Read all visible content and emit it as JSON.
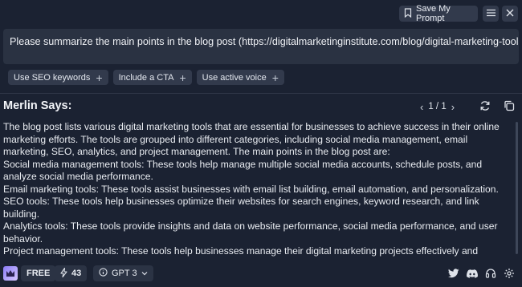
{
  "topbar": {
    "save_label": "Save My Prompt"
  },
  "prompt": {
    "text": "Please summarize the main points in the blog post (https://digitalmarketinginstitute.com/blog/digital-marketing-tools)"
  },
  "chips": [
    {
      "label": "Use SEO keywords"
    },
    {
      "label": "Include a CTA"
    },
    {
      "label": "Use active voice"
    }
  ],
  "merlin": {
    "title": "Merlin Says:",
    "pager": "1 / 1"
  },
  "response": {
    "paragraphs": [
      "The blog post lists various digital marketing tools that are essential for businesses to achieve success in their online marketing efforts. The tools are grouped into different categories, including social media management, email marketing, SEO, analytics, and project management. The main points in the blog post are:",
      "Social media management tools: These tools help manage multiple social media accounts, schedule posts, and analyze social media performance.",
      "Email marketing tools: These tools assist businesses with email list building, email automation, and personalization.",
      "SEO tools: These tools help businesses optimize their websites for search engines, keyword research, and link building.",
      "Analytics tools: These tools provide insights and data on website performance, social media performance, and user behavior.",
      "Project management tools: These tools help businesses manage their digital marketing projects effectively and efficiently."
    ]
  },
  "footer": {
    "plan": "FREE",
    "credits": "43",
    "model": "GPT 3"
  }
}
